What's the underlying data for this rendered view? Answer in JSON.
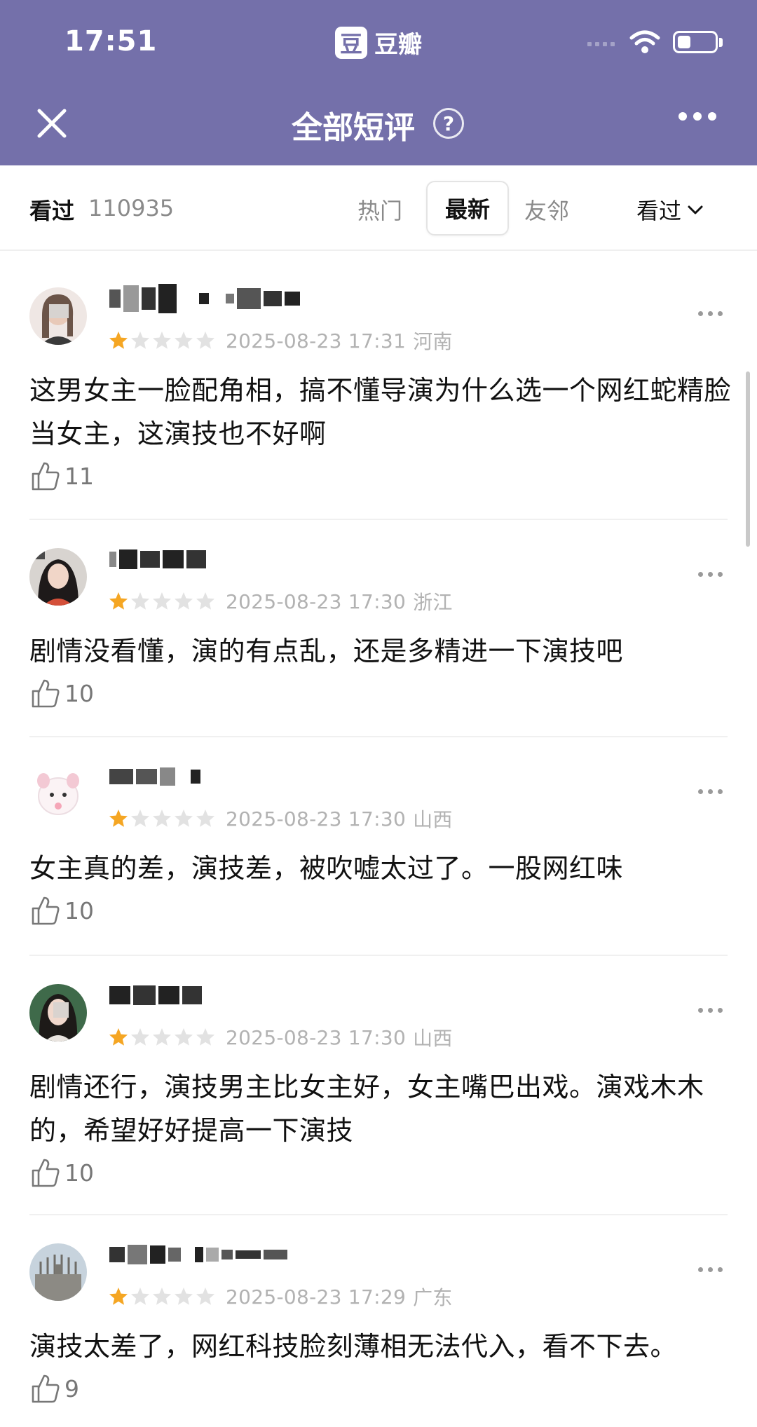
{
  "status_bar": {
    "time": "17:51",
    "app_logo": "豆",
    "app_name": "豆瓣"
  },
  "header": {
    "title": "全部短评",
    "help_symbol": "?"
  },
  "filter_bar": {
    "seen_label": "看过",
    "seen_count": "110935",
    "tabs": [
      "热门",
      "最新",
      "友邻"
    ],
    "active_tab": "最新",
    "filter_value": "看过"
  },
  "colors": {
    "header": "#7470aa",
    "star_on": "#f5a623",
    "star_off": "#e2e2e2",
    "meta": "#b2b2b2"
  },
  "comments": [
    {
      "rating": 1,
      "date": "2025-08-23 17:31",
      "region": "河南",
      "text": "这男女主一脸配角相，搞不懂导演为什么选一个网红蛇精脸当女主，这演技也不好啊",
      "likes": "11",
      "avatar_icon": "avatar-photo-icon"
    },
    {
      "rating": 1,
      "date": "2025-08-23 17:30",
      "region": "浙江",
      "text": "剧情没看懂，演的有点乱，还是多精进一下演技吧",
      "likes": "10",
      "avatar_icon": "avatar-photo-icon"
    },
    {
      "rating": 1,
      "date": "2025-08-23 17:30",
      "region": "山西",
      "text": "女主真的差，演技差，被吹嘘太过了。一股网红味",
      "likes": "10",
      "avatar_icon": "avatar-cartoon-icon"
    },
    {
      "rating": 1,
      "date": "2025-08-23 17:30",
      "region": "山西",
      "text": "剧情还行，演技男主比女主好，女主嘴巴出戏。演戏木木的，希望好好提高一下演技",
      "likes": "10",
      "avatar_icon": "avatar-photo-icon"
    },
    {
      "rating": 1,
      "date": "2025-08-23 17:29",
      "region": "广东",
      "text": "演技太差了，网红科技脸刻薄相无法代入，看不下去。",
      "likes": "9",
      "avatar_icon": "avatar-building-icon"
    }
  ]
}
